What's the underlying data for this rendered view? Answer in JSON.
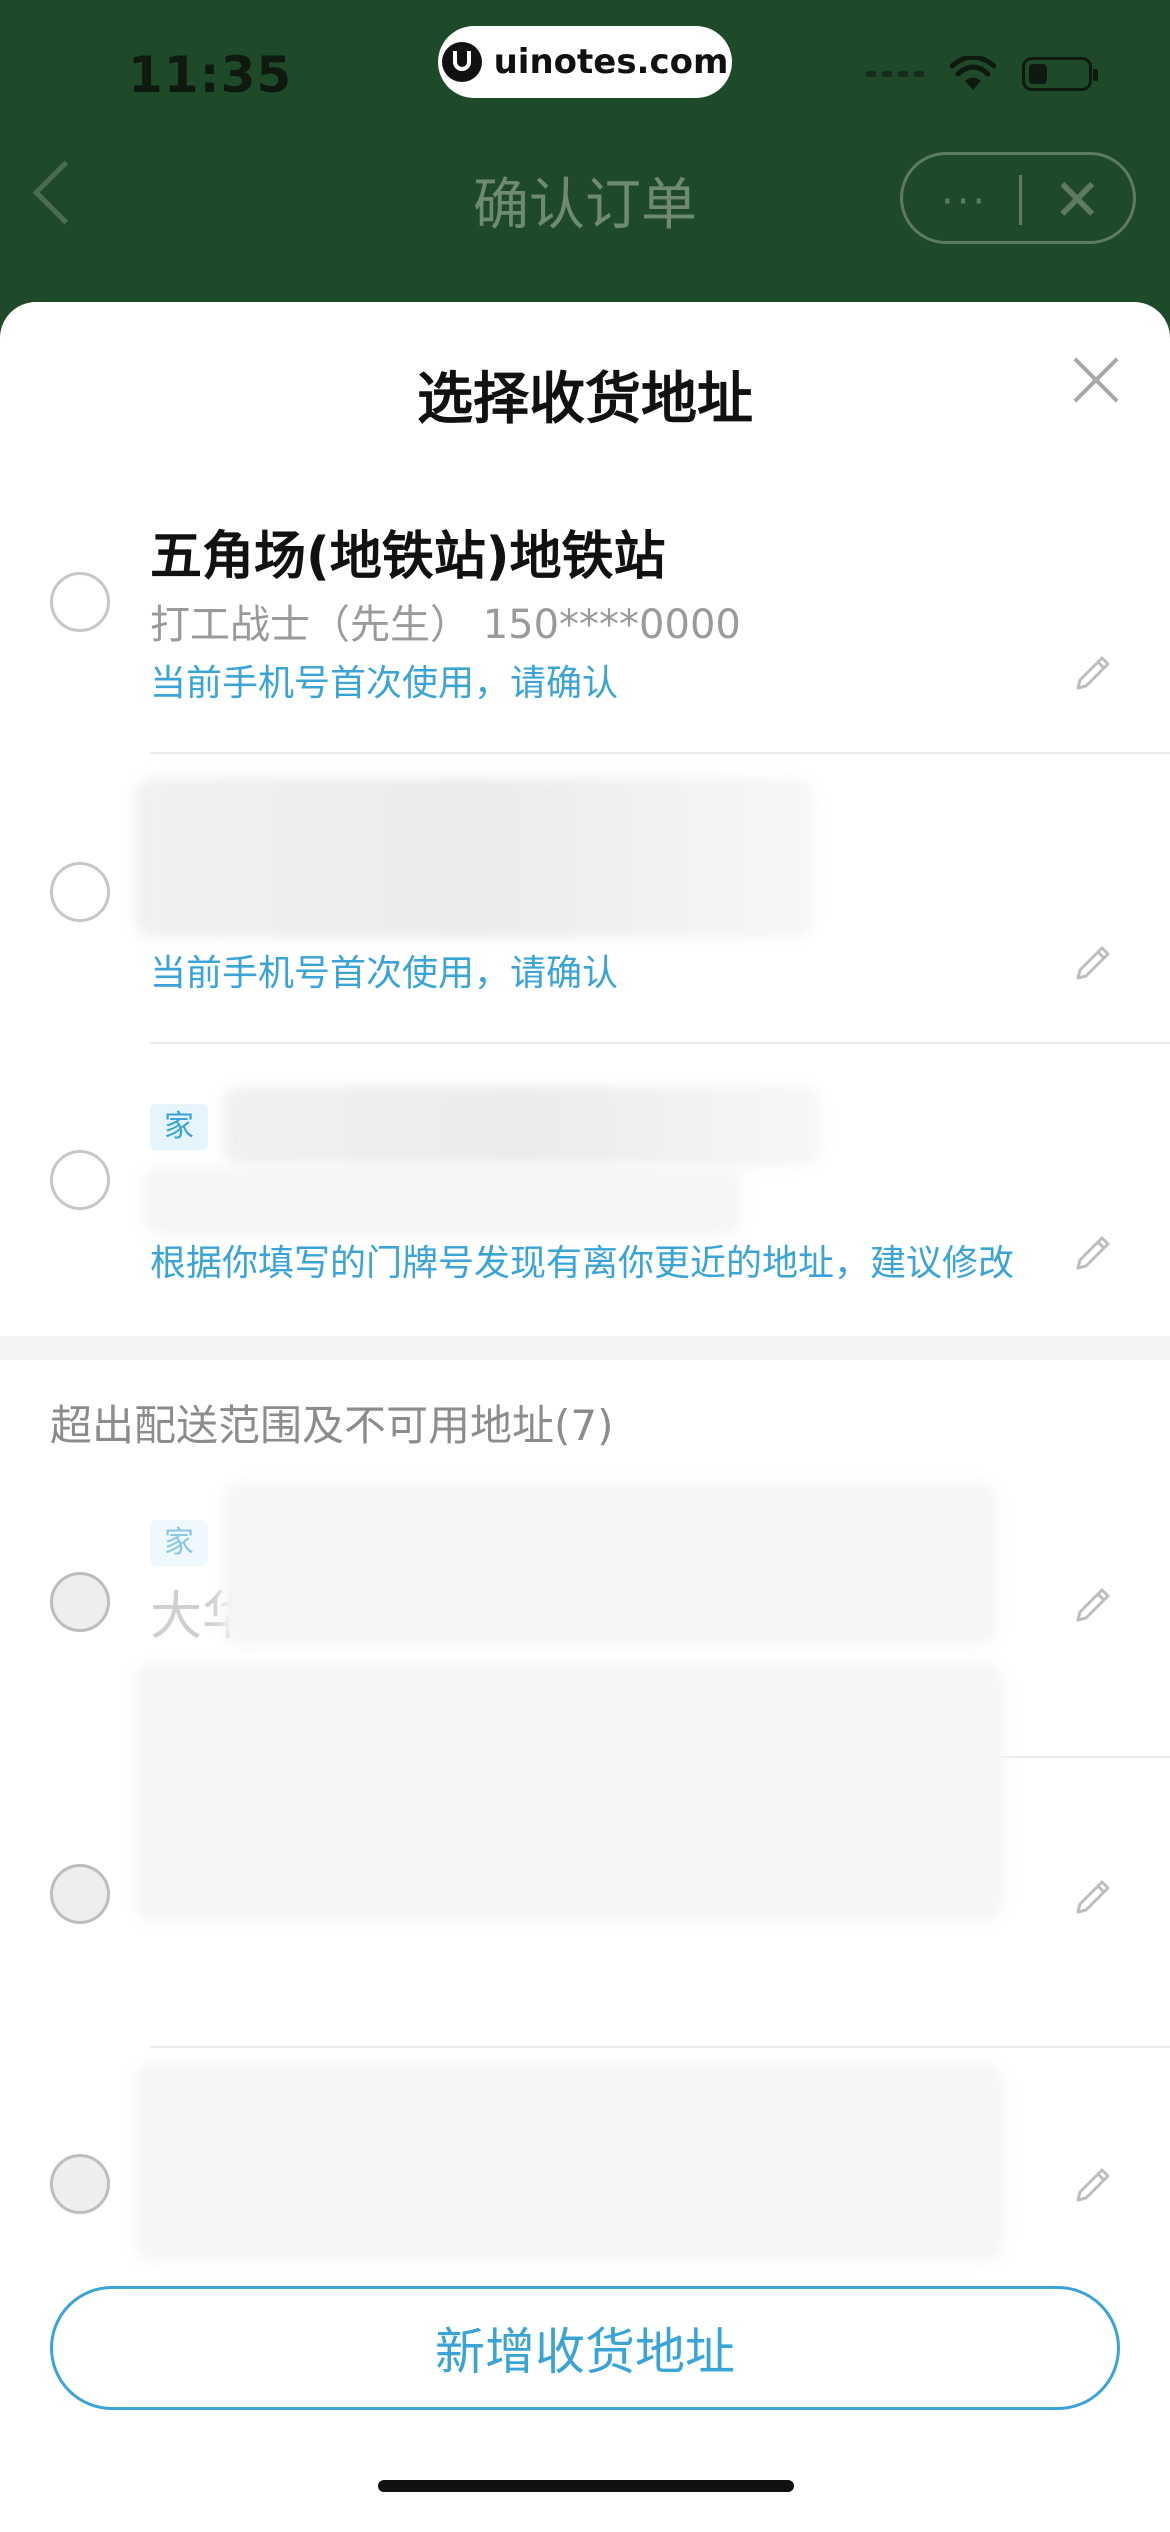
{
  "status_bar": {
    "time": "11:35",
    "url": "uinotes.com"
  },
  "nav": {
    "title": "确认订单",
    "more": "···",
    "close": "✕"
  },
  "sheet": {
    "title": "选择收货地址",
    "close_icon": "close-icon"
  },
  "addresses": [
    {
      "name": "五角场(地铁站)地铁站",
      "contact": "打工战士（先生） 150****0000",
      "note": "当前手机号首次使用，请确认"
    },
    {
      "name": "",
      "contact": "",
      "note": "当前手机号首次使用，请确认"
    },
    {
      "tag": "家",
      "name": "",
      "contact": "",
      "note": "根据你填写的门牌号发现有离你更近的地址，建议修改"
    }
  ],
  "unavailable": {
    "title": "超出配送范围及不可用地址(7)",
    "items": [
      {
        "tag": "家",
        "name_fragment": "大华"
      },
      {
        "tag": "",
        "name_fragment": ""
      },
      {
        "tag": "",
        "name_fragment": ""
      }
    ]
  },
  "add_button": {
    "label": "新增收货地址"
  },
  "colors": {
    "header_green": "#1f4a2a",
    "accent_blue": "#3aa4d6"
  }
}
